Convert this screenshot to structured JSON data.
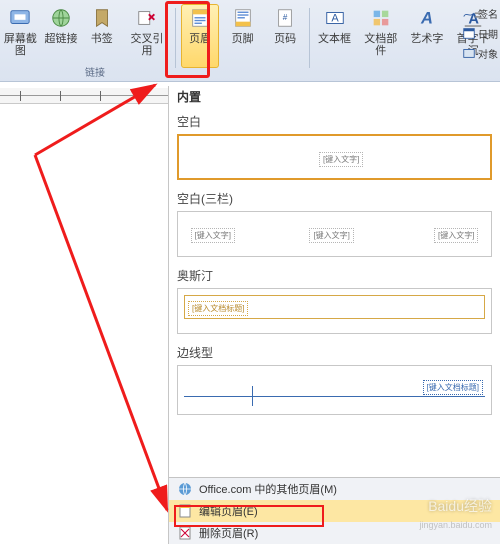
{
  "ribbon": {
    "group_label": "链接",
    "screenshot": "屏幕截图",
    "hyperlink": "超链接",
    "bookmark": "书签",
    "crossref": "交叉引用",
    "header": "页眉",
    "footer": "页脚",
    "pagenum": "页码",
    "textbox": "文本框",
    "quickparts": "文档部件",
    "wordart": "艺术字",
    "dropcap": "首字下沉"
  },
  "right_items": {
    "a": "签名",
    "b": "日期",
    "c": "对象"
  },
  "gallery": {
    "title": "内置",
    "s1": "空白",
    "s2": "空白(三栏)",
    "s3": "奥斯汀",
    "s4": "边线型",
    "ph_text": "[键入文字]",
    "ph_doc": "[键入文档标题]"
  },
  "menu": {
    "more": "Office.com 中的其他页眉(M)",
    "edit": "编辑页眉(E)",
    "remove": "删除页眉(R)"
  },
  "watermark": "Baidu经验",
  "watermark2": "jingyan.baidu.com"
}
